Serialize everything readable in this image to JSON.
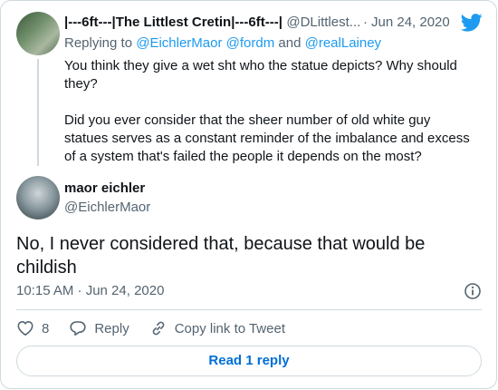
{
  "parent_tweet": {
    "display_name": "|---6ft---|The Littlest Cretin|---6ft---|",
    "handle": "@DLittlest...",
    "separator": "·",
    "date": "Jun 24, 2020",
    "replying_prefix": "Replying to",
    "replying_to": [
      "@EichlerMaor",
      "@fordm"
    ],
    "replying_and": "and",
    "replying_last": "@realLainey",
    "text_paragraphs": [
      "You think they give a wet sht who the statue depicts? Why should they?",
      "Did you ever consider that the sheer number of old white guy statues serves as a constant reminder of the imbalance and excess of a system that's failed the people it depends on the most?"
    ]
  },
  "main_tweet": {
    "display_name": "maor eichler",
    "handle": "@EichlerMaor",
    "text": "No, I never considered that, because that would be childish",
    "time": "10:15 AM · Jun 24, 2020"
  },
  "actions": {
    "like_count": "8",
    "reply_label": "Reply",
    "copy_link_label": "Copy link to Tweet"
  },
  "read_replies_label": "Read 1 reply",
  "icons": {
    "brand": "twitter-bird-icon",
    "info": "info-icon",
    "like": "heart-icon",
    "reply": "speech-bubble-icon",
    "copy_link": "link-icon"
  },
  "colors": {
    "accent": "#1d9bf0",
    "text": "#0f1419",
    "muted": "#536471",
    "border": "#cfd9de",
    "link_button": "#006fd6"
  }
}
